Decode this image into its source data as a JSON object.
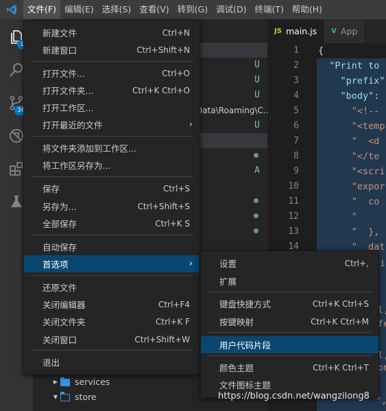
{
  "menubar": {
    "items": [
      "文件(F)",
      "编辑(E)",
      "选择(S)",
      "查看(V)",
      "转到(G)",
      "调试(D)",
      "终端(T)",
      "帮助(H)"
    ]
  },
  "activity": {
    "explorer_badge": "1",
    "scm_badge": "36"
  },
  "sidebar": {
    "path_fragment": "Data\\Roaming\\C...",
    "tree": [
      {
        "label": "services",
        "kind": "folder"
      },
      {
        "label": "store",
        "kind": "folder-open"
      }
    ],
    "status_letters": [
      "U",
      "U",
      "U",
      "U",
      "A"
    ]
  },
  "tabs": [
    {
      "label": "main.js",
      "icon": "JS"
    },
    {
      "label": "App",
      "icon": "V"
    }
  ],
  "editor": {
    "line_numbers": [
      "1",
      "2",
      "3",
      "4",
      "5",
      "6",
      "7",
      "8",
      "9",
      "10",
      "11",
      "12",
      "13",
      "14"
    ],
    "code": [
      "{",
      "  \"Print to",
      "    \"prefix\"",
      "    \"body\":",
      "      \"<!--",
      "      \"<temp",
      "      \"  <d",
      "      \"</te",
      "      \"<scri",
      "      \"expor",
      "      \"  co",
      "      \"",
      "      \"  },",
      "      \"  dat"
    ],
    "bottom_fragments": [
      "i",
      "l,",
      "fe",
      "l,",
      "on",
      "\","
    ]
  },
  "file_menu": {
    "items": [
      {
        "label": "新建文件",
        "shortcut": "Ctrl+N"
      },
      {
        "label": "新建窗口",
        "shortcut": "Ctrl+Shift+N"
      },
      {
        "label": "打开文件...",
        "shortcut": "Ctrl+O"
      },
      {
        "label": "打开文件夹...",
        "shortcut": "Ctrl+K Ctrl+O"
      },
      {
        "label": "打开工作区...",
        "shortcut": ""
      },
      {
        "label": "打开最近的文件",
        "shortcut": ""
      },
      {
        "label": "将文件夹添加到工作区...",
        "shortcut": ""
      },
      {
        "label": "将工作区另存为...",
        "shortcut": ""
      },
      {
        "label": "保存",
        "shortcut": "Ctrl+S"
      },
      {
        "label": "另存为...",
        "shortcut": "Ctrl+Shift+S"
      },
      {
        "label": "全部保存",
        "shortcut": "Ctrl+K S"
      },
      {
        "label": "自动保存",
        "shortcut": ""
      },
      {
        "label": "首选项",
        "shortcut": ""
      },
      {
        "label": "还原文件",
        "shortcut": ""
      },
      {
        "label": "关闭编辑器",
        "shortcut": "Ctrl+F4"
      },
      {
        "label": "关闭文件夹",
        "shortcut": "Ctrl+K F"
      },
      {
        "label": "关闭窗口",
        "shortcut": "Ctrl+Shift+W"
      },
      {
        "label": "退出",
        "shortcut": ""
      }
    ]
  },
  "prefs_menu": {
    "items": [
      {
        "label": "设置",
        "shortcut": "Ctrl+,"
      },
      {
        "label": "扩展",
        "shortcut": ""
      },
      {
        "label": "键盘快捷方式",
        "shortcut": "Ctrl+K Ctrl+S"
      },
      {
        "label": "按键映射",
        "shortcut": "Ctrl+K Ctrl+M"
      },
      {
        "label": "用户代码片段",
        "shortcut": ""
      },
      {
        "label": "颜色主题",
        "shortcut": "Ctrl+K Ctrl+T"
      },
      {
        "label": "文件图标主题",
        "shortcut": ""
      }
    ]
  },
  "watermark": "https://blog.csdn.net/wangzilong8",
  "colors": {
    "accent": "#007acc",
    "menu_selected": "#094771",
    "git_untracked": "#73c991",
    "folder": "#3794e4"
  }
}
